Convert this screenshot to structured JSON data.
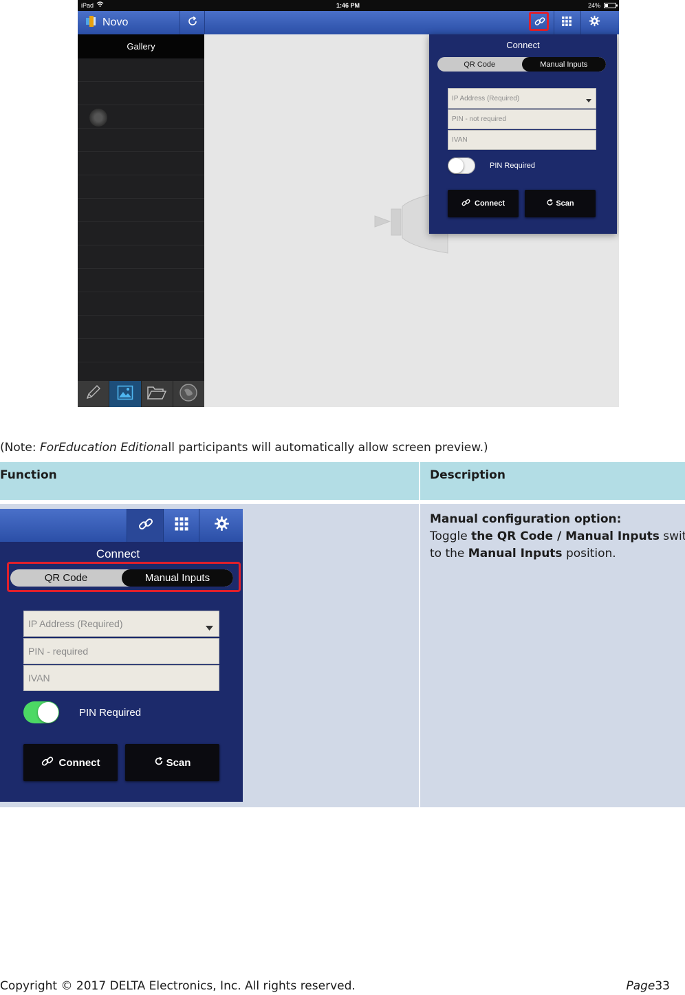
{
  "ipad": {
    "status": {
      "carrier": "iPad",
      "time": "1:46 PM",
      "battery": "24%"
    },
    "app_name": "Novo",
    "sidebar_title": "Gallery",
    "popup": {
      "title": "Connect",
      "segments": [
        "QR Code",
        "Manual Inputs"
      ],
      "selected_segment": "Manual Inputs",
      "ip_placeholder": "IP Address (Required)",
      "pin_placeholder": "PIN - not required",
      "name_value": "IVAN",
      "toggle_label": "PIN Required",
      "toggle_on": false,
      "connect_label": "Connect",
      "scan_label": "Scan"
    }
  },
  "note": {
    "prefix": "(Note: ",
    "italic": "ForEducation Edition",
    "suffix": "all participants will automatically allow screen preview.)"
  },
  "table": {
    "headers": [
      "Function",
      "Description"
    ],
    "zoom": {
      "title": "Connect",
      "segments": [
        "QR Code",
        "Manual Inputs"
      ],
      "selected_segment": "Manual Inputs",
      "ip_placeholder": "IP Address (Required)",
      "pin_placeholder": "PIN - required",
      "name_value": "IVAN",
      "toggle_label": "PIN Required",
      "toggle_on": true,
      "connect_label": "Connect",
      "scan_label": "Scan"
    },
    "description": {
      "heading": "Manual configuration option:",
      "line1_a": "Toggle ",
      "line1_b": "the QR Code / Manual Inputs",
      "line1_c": " switch",
      "line2_a": "to the ",
      "line2_b": "Manual Inputs",
      "line2_c": " position."
    }
  },
  "footer": {
    "copyright": "Copyright © 2017 DELTA Electronics, Inc. All rights reserved.",
    "page_word": "Page",
    "page_number": "33"
  },
  "colors": {
    "toolbar_blue": "#3a5fb8",
    "popup_navy": "#1c2a6b",
    "highlight_red": "#e0202b",
    "toggle_green": "#4cd964",
    "header_cyan": "#b3dde5",
    "cell_lavender": "#d1d9e7"
  },
  "icons": [
    "wifi-icon",
    "battery-icon",
    "novo-logo-icon",
    "refresh-icon",
    "link-icon",
    "grid-icon",
    "gear-icon",
    "pencil-icon",
    "image-icon",
    "folder-icon",
    "globe-icon",
    "dropdown-arrow-icon",
    "refresh-icon"
  ]
}
